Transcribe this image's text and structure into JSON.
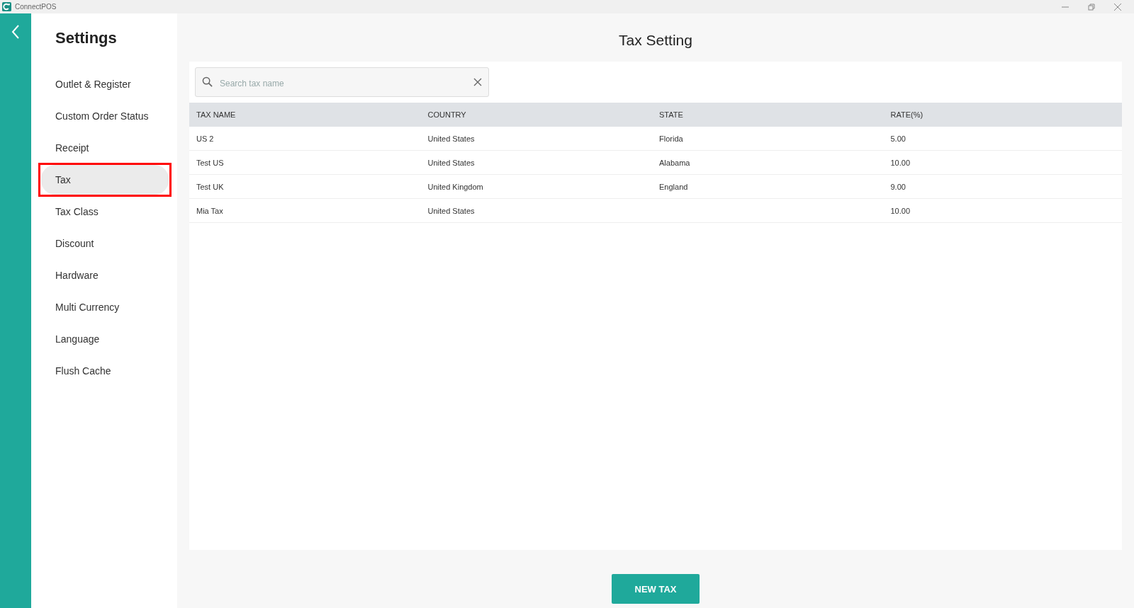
{
  "window": {
    "title": "ConnectPOS"
  },
  "sidebar": {
    "title": "Settings",
    "items": [
      {
        "label": "Outlet & Register",
        "selected": false,
        "highlighted": false
      },
      {
        "label": "Custom Order Status",
        "selected": false,
        "highlighted": false
      },
      {
        "label": "Receipt",
        "selected": false,
        "highlighted": false
      },
      {
        "label": "Tax",
        "selected": true,
        "highlighted": true
      },
      {
        "label": "Tax Class",
        "selected": false,
        "highlighted": false
      },
      {
        "label": "Discount",
        "selected": false,
        "highlighted": false
      },
      {
        "label": "Hardware",
        "selected": false,
        "highlighted": false
      },
      {
        "label": "Multi Currency",
        "selected": false,
        "highlighted": false
      },
      {
        "label": "Language",
        "selected": false,
        "highlighted": false
      },
      {
        "label": "Flush Cache",
        "selected": false,
        "highlighted": false
      }
    ]
  },
  "page_title": "Tax Setting",
  "search": {
    "placeholder": "Search tax name"
  },
  "table": {
    "columns": [
      "TAX NAME",
      "COUNTRY",
      "STATE",
      "RATE(%)"
    ],
    "rows": [
      [
        "US 2",
        "United States",
        "Florida",
        "5.00"
      ],
      [
        "Test US",
        "United States",
        "Alabama",
        "10.00"
      ],
      [
        "Test UK",
        "United Kingdom",
        "England",
        "9.00"
      ],
      [
        "Mia Tax",
        "United States",
        "",
        "10.00"
      ]
    ]
  },
  "buttons": [
    "NEW TAX"
  ]
}
